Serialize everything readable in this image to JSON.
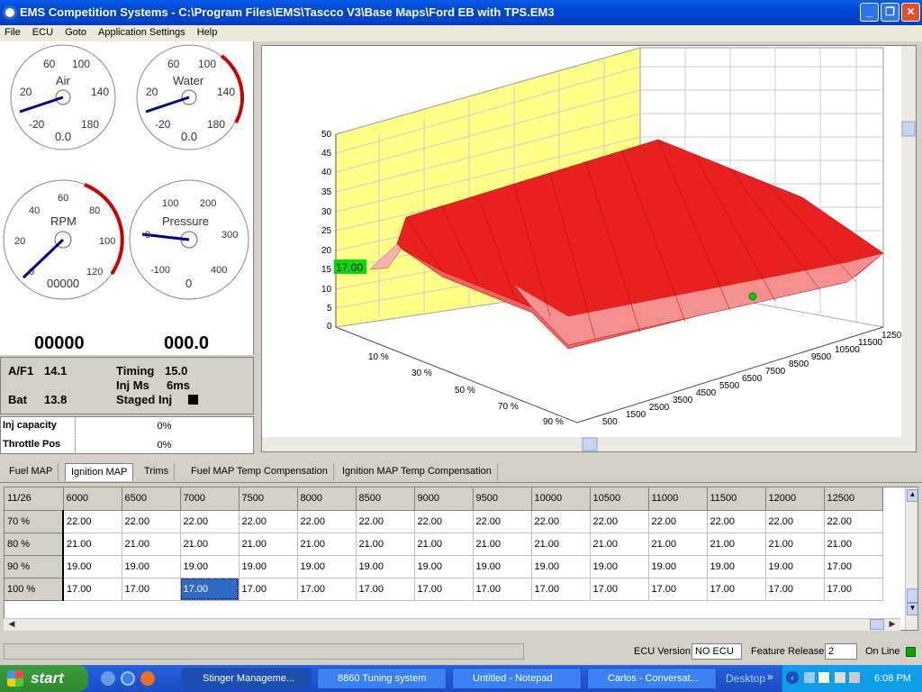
{
  "window": {
    "title": "EMS Competition Systems - C:\\Program Files\\EMS\\Tascco V3\\Base Maps\\Ford EB with TPS.EM3",
    "minimize": "_",
    "maximize": "❐",
    "close": "✕"
  },
  "menu": [
    "File",
    "ECU",
    "Goto",
    "Application Settings",
    "Help"
  ],
  "gauges": {
    "air": {
      "label": "Air",
      "value": "0.0",
      "ticks": [
        "60",
        "100",
        "20",
        "140",
        "-20",
        "180"
      ]
    },
    "water": {
      "label": "Water",
      "value": "0.0",
      "ticks": [
        "60",
        "100",
        "20",
        "140",
        "-20",
        "180"
      ]
    },
    "rpm": {
      "label": "RPM",
      "value": "00000",
      "ticks": [
        "60",
        "40",
        "80",
        "20",
        "100",
        "0",
        "120"
      ],
      "big": "00000"
    },
    "pressure": {
      "label": "Pressure",
      "value": "0",
      "ticks": [
        "100",
        "200",
        "0",
        "300",
        "-100",
        "400"
      ],
      "big": "000.0"
    }
  },
  "readouts": {
    "af_label": "A/F1",
    "af_value": "14.1",
    "timing_label": "Timing",
    "timing_value": "15.0",
    "injms_label": "Inj Ms",
    "injms_value": "6ms",
    "bat_label": "Bat",
    "bat_value": "13.8",
    "staged_label": "Staged Inj"
  },
  "capacity": {
    "inj_label": "Inj capacity",
    "inj_value": "0%",
    "tps_label": "Throttle Pos",
    "tps_value": "0%"
  },
  "plot": {
    "y_ticks": [
      "50",
      "45",
      "40",
      "35",
      "30",
      "25",
      "20",
      "15",
      "10",
      "5",
      "0"
    ],
    "cursor_value": "17.00",
    "load_ticks": [
      "10 %",
      "30 %",
      "50 %",
      "70 %",
      "90 %"
    ],
    "rpm_ticks": [
      "500",
      "1500",
      "2500",
      "3500",
      "4500",
      "5500",
      "6500",
      "7500",
      "8500",
      "9500",
      "10500",
      "11500",
      "1250"
    ]
  },
  "tabs": [
    "Fuel MAP",
    "Ignition MAP",
    "Trims",
    "Fuel MAP Temp Compensation",
    "Ignition MAP Temp Compensation"
  ],
  "table": {
    "corner": "11/26",
    "columns": [
      "6000",
      "6500",
      "7000",
      "7500",
      "8000",
      "8500",
      "9000",
      "9500",
      "10000",
      "10500",
      "11000",
      "11500",
      "12000",
      "12500"
    ],
    "rows": [
      {
        "label": "70 %",
        "cells": [
          "22.00",
          "22.00",
          "22.00",
          "22.00",
          "22.00",
          "22.00",
          "22.00",
          "22.00",
          "22.00",
          "22.00",
          "22.00",
          "22.00",
          "22.00",
          "22.00"
        ]
      },
      {
        "label": "80 %",
        "cells": [
          "21.00",
          "21.00",
          "21.00",
          "21.00",
          "21.00",
          "21.00",
          "21.00",
          "21.00",
          "21.00",
          "21.00",
          "21.00",
          "21.00",
          "21.00",
          "21.00"
        ]
      },
      {
        "label": "90 %",
        "cells": [
          "19.00",
          "19.00",
          "19.00",
          "19.00",
          "19.00",
          "19.00",
          "19.00",
          "19.00",
          "19.00",
          "19.00",
          "19.00",
          "19.00",
          "19.00",
          "17.00"
        ]
      },
      {
        "label": "100 %",
        "cells": [
          "17.00",
          "17.00",
          "17.00",
          "17.00",
          "17.00",
          "17.00",
          "17.00",
          "17.00",
          "17.00",
          "17.00",
          "17.00",
          "17.00",
          "17.00",
          "17.00"
        ]
      }
    ],
    "selected": {
      "row": 3,
      "col": 2
    }
  },
  "status": {
    "ecu_label": "ECU Version",
    "ecu_value": "NO ECU",
    "feature_label": "Feature Release",
    "feature_value": "2",
    "online_label": "On Line"
  },
  "taskbar": {
    "start": "start",
    "tasks": [
      "Stinger Manageme...",
      "8860 Tuning system",
      "Untitled - Notepad",
      "Carlos - Conversat..."
    ],
    "desktop": "Desktop",
    "time": "6:08 PM"
  },
  "colors": {
    "surface_red": "#e02020",
    "yellow_wall": "#ffff88",
    "online": "#00aa00",
    "accent": "#316ac5"
  }
}
